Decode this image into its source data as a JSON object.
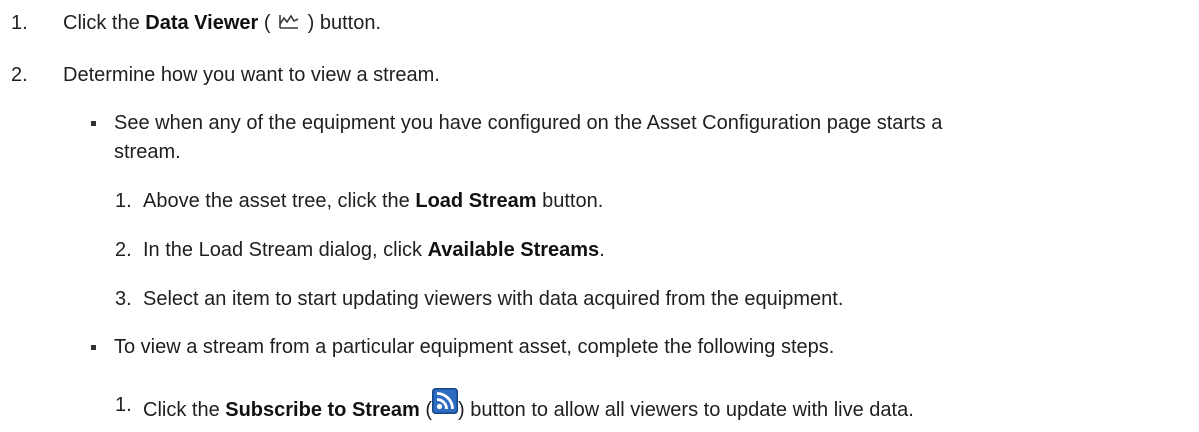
{
  "steps": {
    "s1": {
      "number": "1.",
      "pre": "Click the ",
      "bold": "Data Viewer",
      "open": " (",
      "icon": "data-viewer-icon",
      "close": " ) button."
    },
    "s2": {
      "number": "2.",
      "text": "Determine how you want to view a stream."
    }
  },
  "bullets": {
    "b1": {
      "line1": "See when any of the equipment you have configured on the Asset Configuration page starts a",
      "line2": "stream.",
      "substeps": [
        {
          "number": "1.",
          "pre": "Above the asset tree, click the ",
          "bold": "Load Stream",
          "post": " button."
        },
        {
          "number": "2.",
          "pre": "In the Load Stream dialog, click ",
          "bold": "Available Streams",
          "post": "."
        },
        {
          "number": "3.",
          "text": "Select an item to start updating viewers with data acquired from the equipment."
        }
      ]
    },
    "b2": {
      "text": "To view a stream from a particular equipment asset, complete the following steps.",
      "substeps": [
        {
          "number": "1.",
          "pre": "Click the ",
          "bold": "Subscribe to Stream",
          "open": " (",
          "icon": "rss-feed-icon",
          "post": ") button to allow all viewers to update with live data."
        }
      ]
    }
  },
  "colors": {
    "text": "#1f1f1f",
    "icon_blue": "#1e5aa8",
    "icon_dark": "#3a3a3a"
  }
}
